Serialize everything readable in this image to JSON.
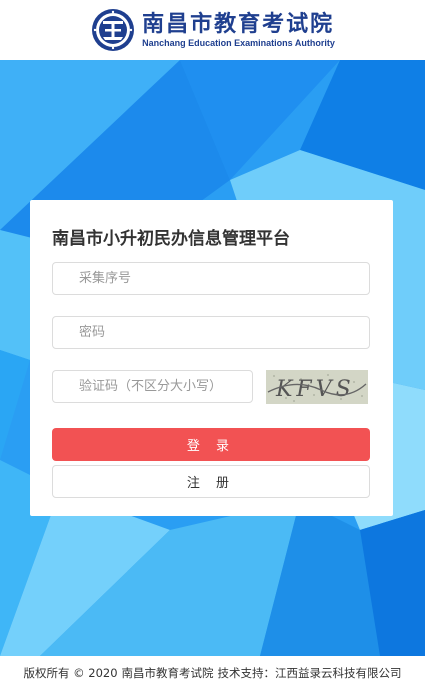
{
  "header": {
    "name_cn": "南昌市教育考试院",
    "name_en": "Nanchang Education Examinations Authority",
    "emblem_icon": "education-emblem-icon"
  },
  "login": {
    "title": "南昌市小升初民办信息管理平台",
    "username_placeholder": "采集序号",
    "password_placeholder": "密码",
    "captcha_placeholder": "验证码（不区分大小写）",
    "captcha_text": "KFVS",
    "login_button": "登 录",
    "register_button": "注 册"
  },
  "footer": {
    "copyright": "版权所有 © 2020",
    "org": "南昌市教育考试院",
    "support": "技术支持：江西益录云科技有限公司"
  },
  "colors": {
    "primary_blue": "#2a9ef3",
    "login_red": "#f25253",
    "logo_navy": "#1f3f8f"
  }
}
